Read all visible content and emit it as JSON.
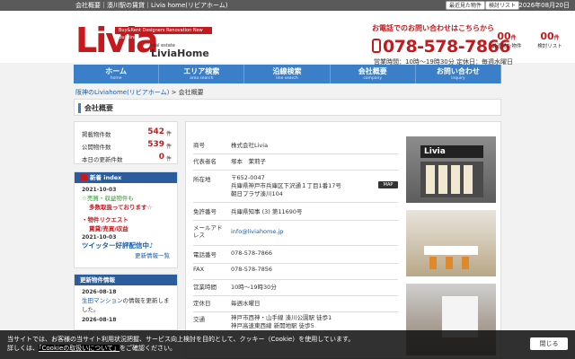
{
  "topbar": {
    "left": "会社概要｜湊川駅の賃貸｜Livia home(リビアホーム)",
    "right": "最終更新 : 2026年08月20日"
  },
  "top_mini": {
    "recent": "最近見た物件",
    "review": "検討リスト"
  },
  "logo": {
    "word": "Livia",
    "tag": "Buy&Rent Designers Renovation New Building",
    "sub1": "real estate",
    "sub2": "LiviaHome"
  },
  "header": {
    "note": "お電話でのお問い合わせはこちらから",
    "phone": "078-578-7866",
    "hours": "営業時間：10時～19時30分 定休日：毎週水曜日"
  },
  "tools": [
    {
      "count": "00",
      "unit": "件",
      "label": "最近見た物件"
    },
    {
      "count": "00",
      "unit": "件",
      "label": "検討リスト"
    }
  ],
  "nav": [
    {
      "jp": "ホーム",
      "en": "home"
    },
    {
      "jp": "エリア検索",
      "en": "area search"
    },
    {
      "jp": "沿線検索",
      "en": "line search"
    },
    {
      "jp": "会社概要",
      "en": "company"
    },
    {
      "jp": "お問い合わせ",
      "en": "inquiry"
    }
  ],
  "breadcrumb": {
    "home": "阪神のLiviahome(リビアホーム)",
    "sep": ">",
    "current": "会社概要"
  },
  "page_title": "会社概要",
  "stats": [
    {
      "label": "掲載物件数",
      "value": "542",
      "unit": "件"
    },
    {
      "label": "公開物件数",
      "value": "539",
      "unit": "件"
    },
    {
      "label": "本日の更新件数",
      "value": "0",
      "unit": "件"
    }
  ],
  "news_panel": {
    "title": "新着 index",
    "items": [
      {
        "date": "2021-10-03",
        "lines": [
          "☆売買・収益物件も",
          "多数取扱っております☆"
        ],
        "style": "g"
      },
      {
        "date": "",
        "lines": [
          "・物件リクエスト",
          "賃貸/売買/収益"
        ],
        "style": "r"
      },
      {
        "date": "2021-10-03",
        "lines": [
          "ツイッター好評配信中♪"
        ],
        "style": "bl"
      }
    ],
    "more": "更新情報一覧"
  },
  "update_panel": {
    "title": "更新物件情報",
    "items": [
      {
        "date": "2026-08-18",
        "text": "生田マンション",
        "suffix": "の情報を更新しました。"
      },
      {
        "date": "2026-08-18",
        "text": "",
        "suffix": ""
      }
    ]
  },
  "company": [
    {
      "key": "商号",
      "value": "株式会社Livia"
    },
    {
      "key": "代表者名",
      "value": "塚本　茉莉子"
    },
    {
      "key": "所在地",
      "value": "〒652-0047\n兵庫県神戸市兵庫区下沢通１丁目1番17号\n朝日プラザ湊川104",
      "map": "MAP"
    },
    {
      "key": "免許番号",
      "value": "兵庫県知事 (3) 第11690号"
    },
    {
      "key": "メールアドレス",
      "value": "info@liviahome.jp"
    },
    {
      "key": "電話番号",
      "value": "078-578-7866"
    },
    {
      "key": "FAX",
      "value": "078-578-7856"
    },
    {
      "key": "営業時間",
      "value": "10時～19時30分"
    },
    {
      "key": "定休日",
      "value": "毎週水曜日"
    },
    {
      "key": "交通",
      "value": "神戸市西神・山手線 湊川公園駅 徒歩1\n神戸高速東西線 新開地駅 徒歩5"
    }
  ],
  "photo_sign": "Livia",
  "cookie": {
    "line1": "当サイトでは、お客様の当サイト利用状況把握、サービス向上検討を目的として、クッキー（Cookie）を使用しています。",
    "line2_pre": "詳しくは、",
    "link": "「Cookieの取扱いについて」",
    "line2_post": "をご確認ください。",
    "close": "閉じる"
  },
  "colors": {
    "brand_red": "#c41a1e",
    "nav_blue": "#3b7fc8",
    "panel_blue": "#2b5d9c"
  }
}
